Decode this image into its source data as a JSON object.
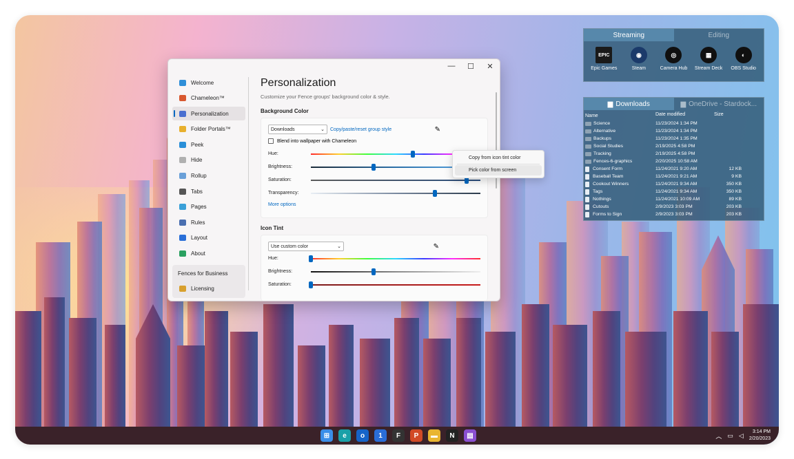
{
  "taskbar": {
    "apps": [
      {
        "icon": "windows-start-icon",
        "glyph": "⊞",
        "color": "#3b8ee8"
      },
      {
        "icon": "edge-icon",
        "glyph": "e",
        "color": "#1aa0a8"
      },
      {
        "icon": "outlook-icon",
        "glyph": "o",
        "color": "#1664c8"
      },
      {
        "icon": "onepassword-icon",
        "glyph": "1",
        "color": "#2a6dd8"
      },
      {
        "icon": "fences-icon",
        "glyph": "F",
        "color": "#333333"
      },
      {
        "icon": "powerpoint-icon",
        "glyph": "P",
        "color": "#d24a26"
      },
      {
        "icon": "file-explorer-icon",
        "glyph": "▬",
        "color": "#e9b531"
      },
      {
        "icon": "notion-icon",
        "glyph": "N",
        "color": "#222222"
      },
      {
        "icon": "stardock-icon",
        "glyph": "▤",
        "color": "#8a4fd1"
      }
    ],
    "time": "3:14 PM",
    "date": "2/20/2023"
  },
  "window": {
    "minimize": "—",
    "maximize": "☐",
    "close": "✕",
    "nav": [
      {
        "label": "Welcome",
        "icon": "welcome-icon",
        "color": "#2f8fd8"
      },
      {
        "label": "Chameleon™",
        "icon": "chameleon-icon",
        "color": "#d8582f"
      },
      {
        "label": "Personalization",
        "icon": "personalization-icon",
        "color": "#4a6fd0"
      },
      {
        "label": "Folder Portals™",
        "icon": "folder-icon",
        "color": "#e8b02e"
      },
      {
        "label": "Peek",
        "icon": "peek-icon",
        "color": "#2a8fd8"
      },
      {
        "label": "Hide",
        "icon": "hide-icon",
        "color": "#b0b0b0"
      },
      {
        "label": "Rollup",
        "icon": "rollup-icon",
        "color": "#6aa0d8"
      },
      {
        "label": "Tabs",
        "icon": "tabs-icon",
        "color": "#555555"
      },
      {
        "label": "Pages",
        "icon": "pages-icon",
        "color": "#3aa0d8"
      },
      {
        "label": "Rules",
        "icon": "rules-icon",
        "color": "#4a6fb0"
      },
      {
        "label": "Layout",
        "icon": "layout-icon",
        "color": "#2a6fd8"
      },
      {
        "label": "About",
        "icon": "about-icon",
        "color": "#2aa060"
      }
    ],
    "nav_bottom": [
      {
        "label": "Fences for Business"
      },
      {
        "label": "Licensing",
        "icon": "licensing-icon",
        "color": "#d8a02e"
      }
    ],
    "title": "Personalization",
    "subtitle": "Customize your Fence groups' background color & style.",
    "background": {
      "section_title": "Background Color",
      "dropdown_value": "Downloads",
      "link": "Copy/paste/reset group style",
      "blend_label": "Blend into wallpaper with Chameleon",
      "sliders": [
        {
          "label": "Hue:",
          "value": 0.6,
          "bar": "hue"
        },
        {
          "label": "Brightness:",
          "value": 0.37,
          "bar": "bright"
        },
        {
          "label": "Saturation:",
          "value": 0.92,
          "bar": "sat"
        },
        {
          "label": "Transparency:",
          "value": 0.73,
          "bar": "trans"
        }
      ],
      "more_options": "More options"
    },
    "icon_tint": {
      "section_title": "Icon Tint",
      "dropdown_value": "Use custom color",
      "sliders": [
        {
          "label": "Hue:",
          "value": 0.0,
          "bar": "hue"
        },
        {
          "label": "Brightness:",
          "value": 0.37,
          "bar": "bright2"
        },
        {
          "label": "Saturation:",
          "value": 0.0,
          "bar": "sat2"
        }
      ]
    },
    "context_menu": {
      "items": [
        "Copy from icon tint color",
        "Pick color from screen"
      ]
    }
  },
  "fence_streaming": {
    "tabs": [
      "Streaming",
      "Editing"
    ],
    "apps": [
      {
        "label": "Epic Games",
        "icon": "epic-games-icon",
        "glyph": "EPIC"
      },
      {
        "label": "Steam",
        "icon": "steam-icon",
        "glyph": "◉"
      },
      {
        "label": "Camera Hub",
        "icon": "camera-hub-icon",
        "glyph": "◎"
      },
      {
        "label": "Stream Deck",
        "icon": "stream-deck-icon",
        "glyph": "▦"
      },
      {
        "label": "OBS Studio",
        "icon": "obs-studio-icon",
        "glyph": "◐"
      }
    ]
  },
  "fence_downloads": {
    "tabs": [
      "Downloads",
      "OneDrive - Stardock..."
    ],
    "columns": [
      "Name",
      "Date modified",
      "Size"
    ],
    "rows": [
      {
        "name": "Science",
        "date": "11/23/2024 1:34 PM",
        "size": "",
        "kind": "folder"
      },
      {
        "name": "Alternative",
        "date": "11/23/2024 1:34 PM",
        "size": "",
        "kind": "folder"
      },
      {
        "name": "Backups",
        "date": "11/23/2024 1:35 PM",
        "size": "",
        "kind": "folder"
      },
      {
        "name": "Social Studies",
        "date": "2/19/2025 4:58 PM",
        "size": "",
        "kind": "folder"
      },
      {
        "name": "Tracking",
        "date": "2/19/2025 4:58 PM",
        "size": "",
        "kind": "folder"
      },
      {
        "name": "Fences-6-graphics",
        "date": "2/20/2025 10:58 AM",
        "size": "",
        "kind": "folder"
      },
      {
        "name": "Consent Form",
        "date": "11/24/2021 9:20 AM",
        "size": "12 KB",
        "kind": "file"
      },
      {
        "name": "Baseball Team",
        "date": "11/24/2021 9:21 AM",
        "size": "9 KB",
        "kind": "file"
      },
      {
        "name": "Cookout Winners",
        "date": "11/24/2021 9:34 AM",
        "size": "350 KB",
        "kind": "file"
      },
      {
        "name": "Tags",
        "date": "11/24/2021 9:34 AM",
        "size": "350 KB",
        "kind": "file"
      },
      {
        "name": "Nothings",
        "date": "11/24/2021 10:09 AM",
        "size": "89 KB",
        "kind": "file"
      },
      {
        "name": "Cutouts",
        "date": "2/9/2023 3:03 PM",
        "size": "203 KB",
        "kind": "file"
      },
      {
        "name": "Forms to Sign",
        "date": "2/9/2023 3:03 PM",
        "size": "203 KB",
        "kind": "file"
      }
    ]
  }
}
